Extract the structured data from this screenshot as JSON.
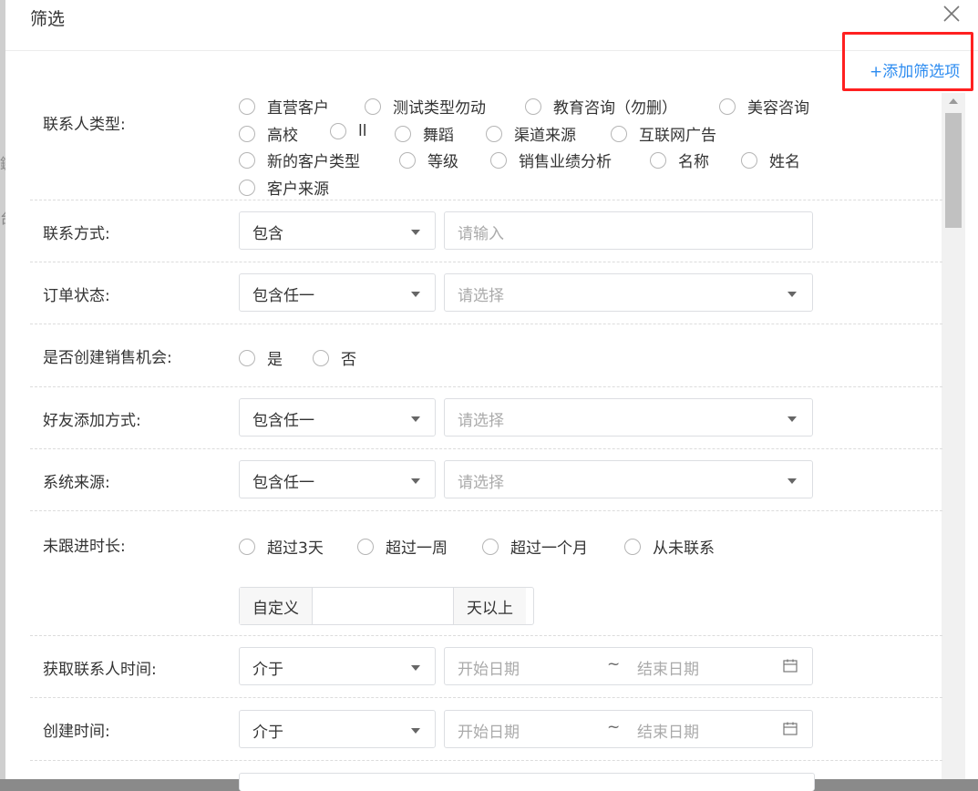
{
  "dialog": {
    "title": "筛选",
    "add_filter": "+添加筛选项"
  },
  "backdrop": {
    "text1": "鍵",
    "text2": "台"
  },
  "contact_type": {
    "label": "联系人类型:",
    "options": [
      "直营客户",
      "测试类型勿动",
      "教育咨询（勿删）",
      "美容咨询",
      "高校",
      "ll",
      "舞蹈",
      "渠道来源",
      "互联网广告",
      "新的客户类型",
      "等级",
      "销售业绩分析",
      "名称",
      "姓名",
      "客户来源"
    ]
  },
  "contact_method": {
    "label": "联系方式:",
    "operator": "包含",
    "placeholder": "请输入"
  },
  "order_status": {
    "label": "订单状态:",
    "operator": "包含任一",
    "placeholder": "请选择"
  },
  "create_opportunity": {
    "label": "是否创建销售机会:",
    "options": [
      "是",
      "否"
    ]
  },
  "friend_add_method": {
    "label": "好友添加方式:",
    "operator": "包含任一",
    "placeholder": "请选择"
  },
  "system_source": {
    "label": "系统来源:",
    "operator": "包含任一",
    "placeholder": "请选择"
  },
  "no_followup": {
    "label": "未跟进时长:",
    "options": [
      "超过3天",
      "超过一周",
      "超过一个月",
      "从未联系"
    ],
    "custom_prefix": "自定义",
    "custom_suffix": "天以上"
  },
  "acquire_time": {
    "label": "获取联系人时间:",
    "operator": "介于",
    "start_placeholder": "开始日期",
    "separator": "~",
    "end_placeholder": "结束日期"
  },
  "create_time": {
    "label": "创建时间:",
    "operator": "介于",
    "start_placeholder": "开始日期",
    "separator": "~",
    "end_placeholder": "结束日期"
  },
  "colors": {
    "accent": "#2d8cf0",
    "highlight": "#ff2020"
  }
}
